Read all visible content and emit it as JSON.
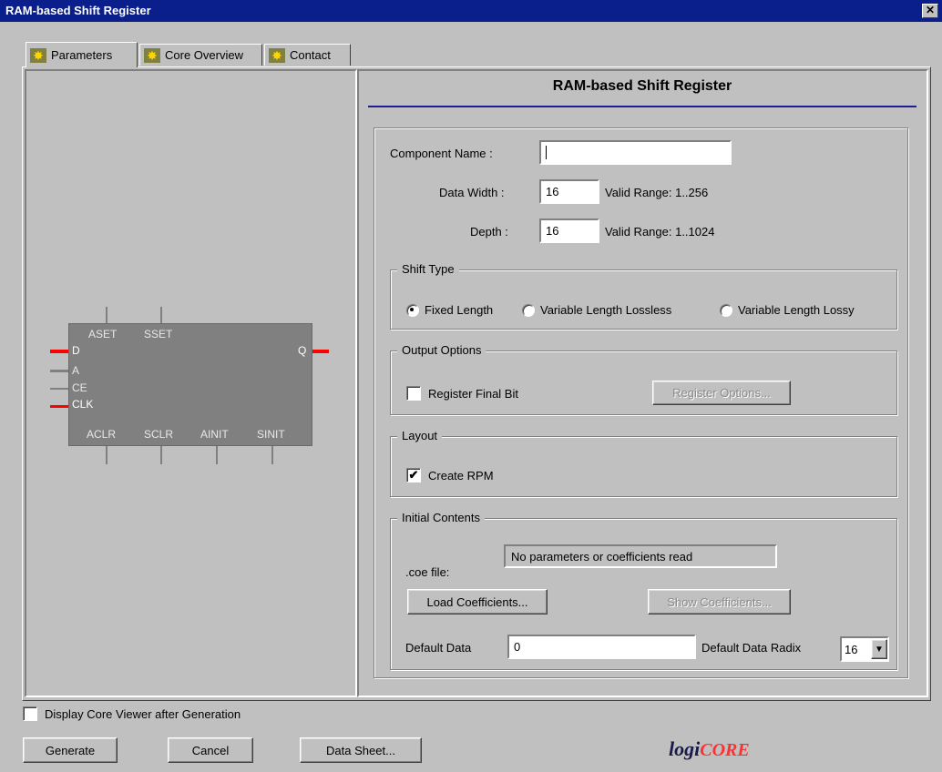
{
  "window": {
    "title": "RAM-based Shift Register",
    "close_icon": "close-icon"
  },
  "tabs": [
    {
      "label": "Parameters",
      "icon": "core-icon",
      "active": true
    },
    {
      "label": "Core Overview",
      "icon": "core-icon",
      "active": false
    },
    {
      "label": "Contact",
      "icon": "core-icon",
      "active": false
    }
  ],
  "symbol": {
    "top_pins": [
      "ASET",
      "SSET"
    ],
    "left_pins": [
      "D",
      "A",
      "CE",
      "CLK"
    ],
    "right_pins": [
      "Q"
    ],
    "bottom_pins": [
      "ACLR",
      "SCLR",
      "AINIT",
      "SINIT"
    ],
    "active_color": "#ff0000",
    "inactive_color": "#808080"
  },
  "panel": {
    "title": "RAM-based Shift Register",
    "title_rule_color": "#1e1e96"
  },
  "form": {
    "component_name": {
      "label": "Component Name :",
      "value": ""
    },
    "data_width": {
      "label": "Data Width :",
      "value": "16",
      "range": "Valid Range: 1..256"
    },
    "depth": {
      "label": "Depth :",
      "value": "16",
      "range": "Valid Range: 1..1024"
    }
  },
  "shift_type": {
    "title": "Shift Type",
    "options": [
      {
        "label": "Fixed Length",
        "selected": true
      },
      {
        "label": "Variable Length Lossless",
        "selected": false
      },
      {
        "label": "Variable Length Lossy",
        "selected": false
      }
    ]
  },
  "output_options": {
    "title": "Output Options",
    "register_final_bit": {
      "label": "Register Final Bit",
      "checked": false
    },
    "register_options_button": "Register Options..."
  },
  "layout": {
    "title": "Layout",
    "create_rpm": {
      "label": "Create RPM",
      "checked": true,
      "mark": "✔"
    }
  },
  "initial_contents": {
    "title": "Initial Contents",
    "coe_label": ".coe file:",
    "coe_status": "No parameters or coefficients read",
    "load_button": "Load Coefficients...",
    "show_button": "Show Coefficients...",
    "default_data_label": "Default Data",
    "default_data_value": "0",
    "radix_label": "Default Data Radix",
    "radix_value": "16",
    "radix_arrow": "▼"
  },
  "footer": {
    "display_viewer": {
      "label": "Display Core Viewer after Generation",
      "checked": false
    },
    "generate": "Generate",
    "cancel": "Cancel",
    "datasheet": "Data Sheet...",
    "logo_text_1": "logi",
    "logo_text_2": "CORE"
  }
}
